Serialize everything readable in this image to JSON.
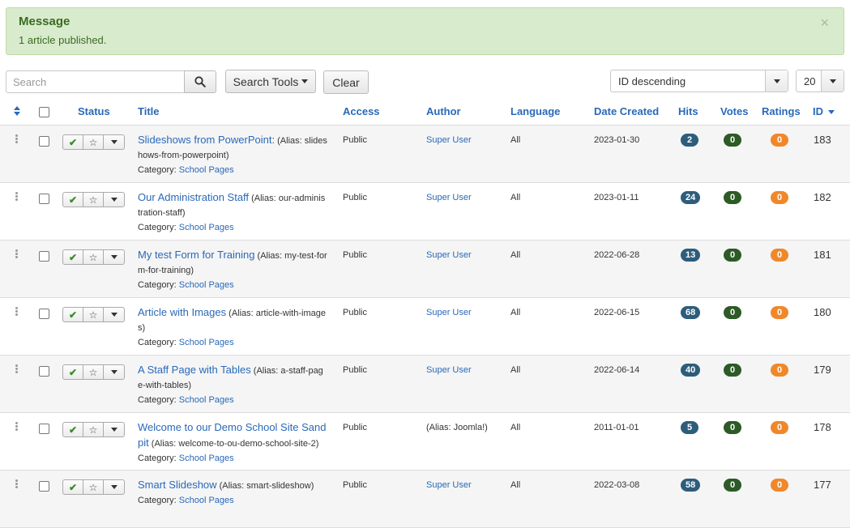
{
  "message": {
    "title": "Message",
    "text": "1 article published.",
    "close": "×"
  },
  "toolbar": {
    "search_placeholder": "Search",
    "search_tools": "Search Tools",
    "clear": "Clear",
    "ordering": "ID descending",
    "limit": "20"
  },
  "columns": {
    "status": "Status",
    "title": "Title",
    "access": "Access",
    "author": "Author",
    "language": "Language",
    "date_created": "Date Created",
    "hits": "Hits",
    "votes": "Votes",
    "ratings": "Ratings",
    "id": "ID"
  },
  "category_label": "Category:",
  "articles": [
    {
      "title": "Slideshows from PowerPoint:",
      "alias": "(Alias: slides hows-from-powerpoint)",
      "category": "School Pages",
      "access": "Public",
      "author": "Super User",
      "author_is_link": true,
      "language": "All",
      "date": "2023-01-30",
      "hits": "2",
      "votes": "0",
      "ratings": "0",
      "id": "183"
    },
    {
      "title": "Our Administration Staff",
      "alias": "(Alias: our-adminis tration-staff)",
      "category": "School Pages",
      "access": "Public",
      "author": "Super User",
      "author_is_link": true,
      "language": "All",
      "date": "2023-01-11",
      "hits": "24",
      "votes": "0",
      "ratings": "0",
      "id": "182"
    },
    {
      "title": "My test Form for Training",
      "alias": "(Alias: my-test-for m-for-training)",
      "category": "School Pages",
      "access": "Public",
      "author": "Super User",
      "author_is_link": true,
      "language": "All",
      "date": "2022-06-28",
      "hits": "13",
      "votes": "0",
      "ratings": "0",
      "id": "181"
    },
    {
      "title": "Article with Images",
      "alias": "(Alias: article-with-image s)",
      "category": "School Pages",
      "access": "Public",
      "author": "Super User",
      "author_is_link": true,
      "language": "All",
      "date": "2022-06-15",
      "hits": "68",
      "votes": "0",
      "ratings": "0",
      "id": "180"
    },
    {
      "title": "A Staff Page with Tables",
      "alias": "(Alias: a-staff-pag e-with-tables)",
      "category": "School Pages",
      "access": "Public",
      "author": "Super User",
      "author_is_link": true,
      "language": "All",
      "date": "2022-06-14",
      "hits": "40",
      "votes": "0",
      "ratings": "0",
      "id": "179"
    },
    {
      "title": "Welcome to our Demo School Site Sand pit",
      "alias": "(Alias: welcome-to-ou-demo-school-site-2)",
      "category": "School Pages",
      "access": "Public",
      "author": "(Alias: Joomla!)",
      "author_is_link": false,
      "language": "All",
      "date": "2011-01-01",
      "hits": "5",
      "votes": "0",
      "ratings": "0",
      "id": "178"
    },
    {
      "title": "Smart Slideshow",
      "alias": "(Alias: smart-slideshow)",
      "category": "School Pages",
      "access": "Public",
      "author": "Super User",
      "author_is_link": true,
      "language": "All",
      "date": "2022-03-08",
      "hits": "58",
      "votes": "0",
      "ratings": "0",
      "id": "177"
    }
  ]
}
